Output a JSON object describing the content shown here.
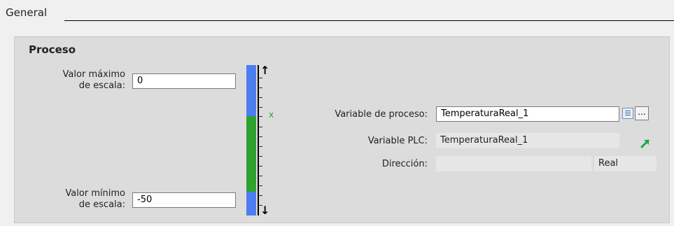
{
  "section": {
    "title": "General"
  },
  "process": {
    "title": "Proceso",
    "max_scale_label_1": "Valor máximo",
    "max_scale_label_2": "de escala:",
    "max_scale_value": "0",
    "min_scale_label_1": "Valor mínimo",
    "min_scale_label_2": "de escala:",
    "min_scale_value": "-50",
    "scale_marker": "x",
    "up_arrow": "↑",
    "down_arrow": "↓"
  },
  "variable": {
    "process_label": "Variable de proceso:",
    "process_value": "TemperaturaReal_1",
    "browse_label": "...",
    "plc_label": "Variable PLC:",
    "plc_value": "TemperaturaReal_1",
    "address_label": "Dirección:",
    "address_value": "",
    "type_value": "Real"
  },
  "colors": {
    "scale_blue": "#4d7df0",
    "scale_green": "#2ea12e",
    "goto_arrow": "#1fa44a"
  },
  "icons": {
    "browse": "list-browse-icon",
    "goto": "goto-arrow-icon"
  }
}
